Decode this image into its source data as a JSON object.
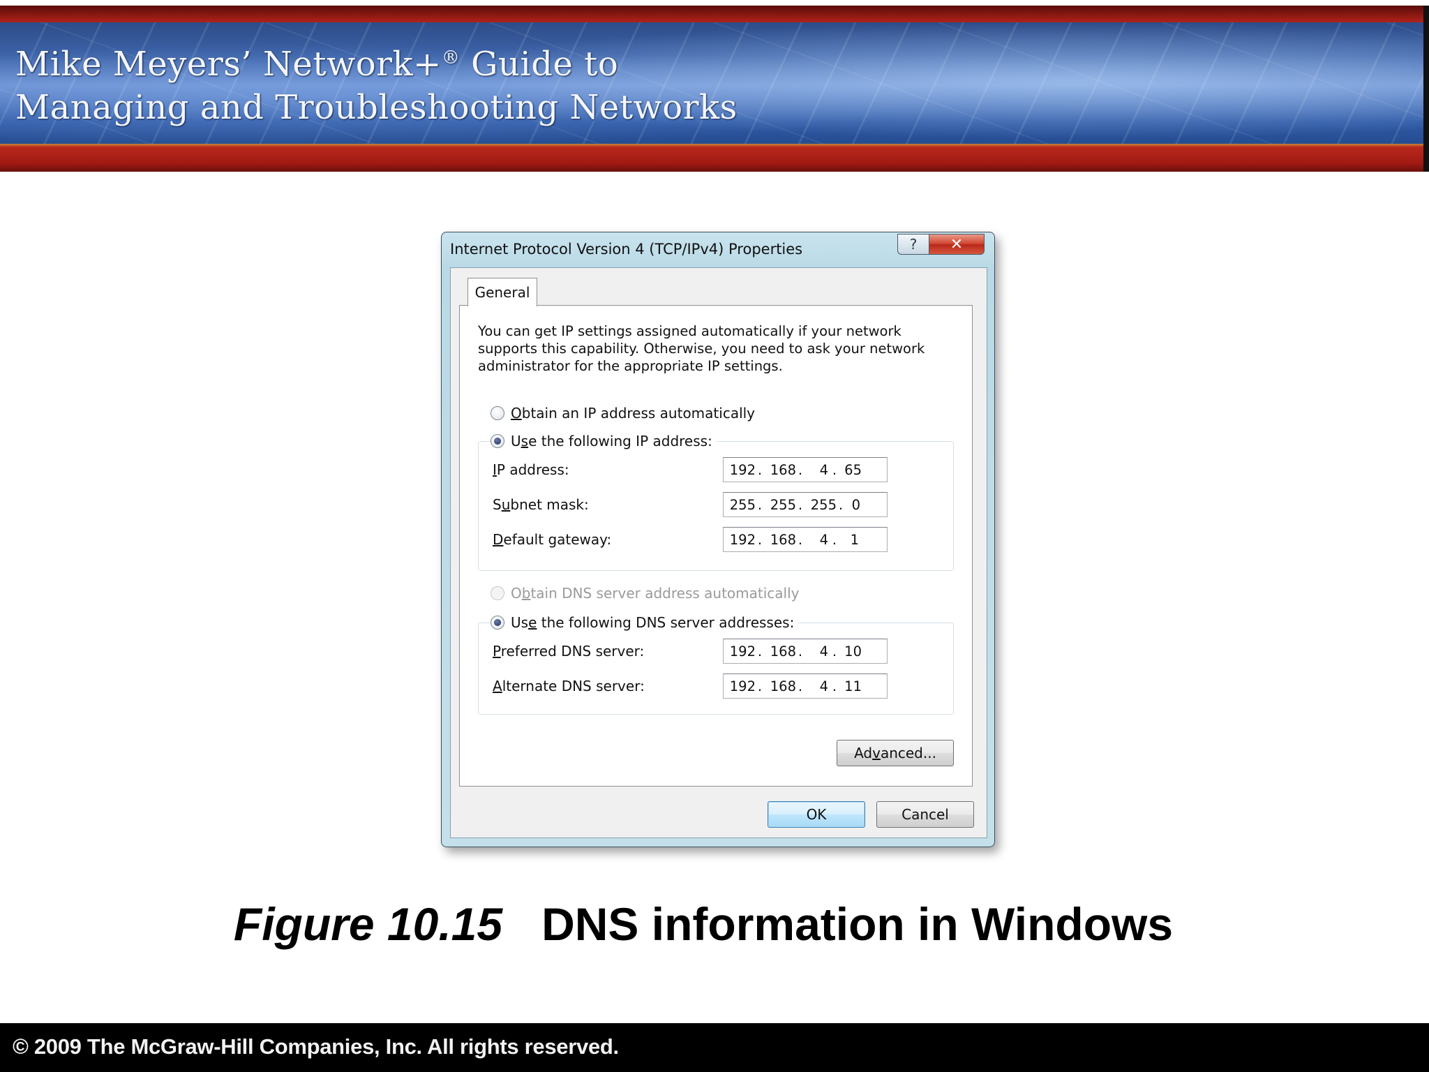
{
  "slide": {
    "title_line1": "Mike Meyers’ Network+",
    "title_mark": "®",
    "title_line1_end": " Guide to",
    "title_line2": "Managing and Troubleshooting Networks"
  },
  "dialog": {
    "title": "Internet Protocol Version 4 (TCP/IPv4) Properties",
    "help_glyph": "?",
    "close_glyph": "✕",
    "tab_general": "General",
    "intro": "You can get IP settings assigned automatically if your network supports this capability. Otherwise, you need to ask your network administrator for the appropriate IP settings.",
    "radio_obtain_ip": {
      "underlined": "O",
      "rest": "btain an IP address automatically"
    },
    "radio_use_ip": {
      "before": "U",
      "underlined": "s",
      "rest": "e the following IP address:"
    },
    "ip_address": {
      "label_u": "I",
      "label_rest": "P address:",
      "octets": [
        "192",
        "168",
        "4",
        "65"
      ]
    },
    "subnet_mask": {
      "label_pre": "S",
      "label_u": "u",
      "label_rest": "bnet mask:",
      "octets": [
        "255",
        "255",
        "255",
        "0"
      ]
    },
    "default_gateway": {
      "label_u": "D",
      "label_rest": "efault gateway:",
      "octets": [
        "192",
        "168",
        "4",
        "1"
      ]
    },
    "radio_obtain_dns": {
      "before": "O",
      "underlined": "b",
      "rest": "tain DNS server address automatically"
    },
    "radio_use_dns": {
      "before": "Us",
      "underlined": "e",
      "rest": " the following DNS server addresses:"
    },
    "preferred_dns": {
      "label_u": "P",
      "label_rest": "referred DNS server:",
      "octets": [
        "192",
        "168",
        "4",
        "10"
      ]
    },
    "alternate_dns": {
      "label_u": "A",
      "label_rest": "lternate DNS server:",
      "octets": [
        "192",
        "168",
        "4",
        "11"
      ]
    },
    "advanced_button": {
      "before": "Ad",
      "underlined": "v",
      "rest": "anced..."
    },
    "ok_button": "OK",
    "cancel_button": "Cancel",
    "octet_separator": "."
  },
  "caption": {
    "figure_number": "Figure 10.15",
    "text": "DNS information in Windows"
  },
  "footer": {
    "copyright": "© 2009 The McGraw-Hill Companies, Inc. All rights reserved."
  }
}
